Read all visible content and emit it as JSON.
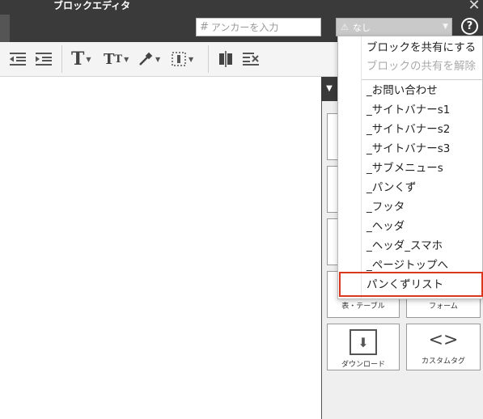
{
  "window": {
    "title": "ブロックエディタ"
  },
  "header": {
    "anchor_placeholder": "アンカーを入力",
    "share_select_value": "なし"
  },
  "toolbar": {
    "items": [
      {
        "name": "outdent-icon"
      },
      {
        "name": "indent-icon"
      },
      {
        "name": "font-size-icon"
      },
      {
        "name": "text-style-icon"
      },
      {
        "name": "eyedropper-icon"
      },
      {
        "name": "border-icon"
      },
      {
        "name": "column-split-icon"
      },
      {
        "name": "delete-block-icon"
      }
    ]
  },
  "panel": {
    "tiles": [
      {
        "label": "表・テーブル"
      },
      {
        "label": "フォーム"
      },
      {
        "label": "ダウンロード"
      },
      {
        "label": "カスタムタグ"
      }
    ]
  },
  "menu": {
    "actions": [
      {
        "label": "ブロックを共有にする",
        "disabled": false
      },
      {
        "label": "ブロックの共有を解除",
        "disabled": true
      }
    ],
    "items": [
      "_お問い合わせ",
      "_サイトバナーs1",
      "_サイトバナーs2",
      "_サイトバナーs3",
      "_サブメニューs",
      "_パンくず",
      "_フッタ",
      "_ヘッダ",
      "_ヘッダ_スマホ",
      "_ページトップへ",
      "パンくずリスト"
    ],
    "highlighted": "パンくずリスト"
  },
  "colors": {
    "header_bg": "#3a3a3a",
    "highlight_border": "#d9381e",
    "select_bg": "#c9c9c9"
  }
}
